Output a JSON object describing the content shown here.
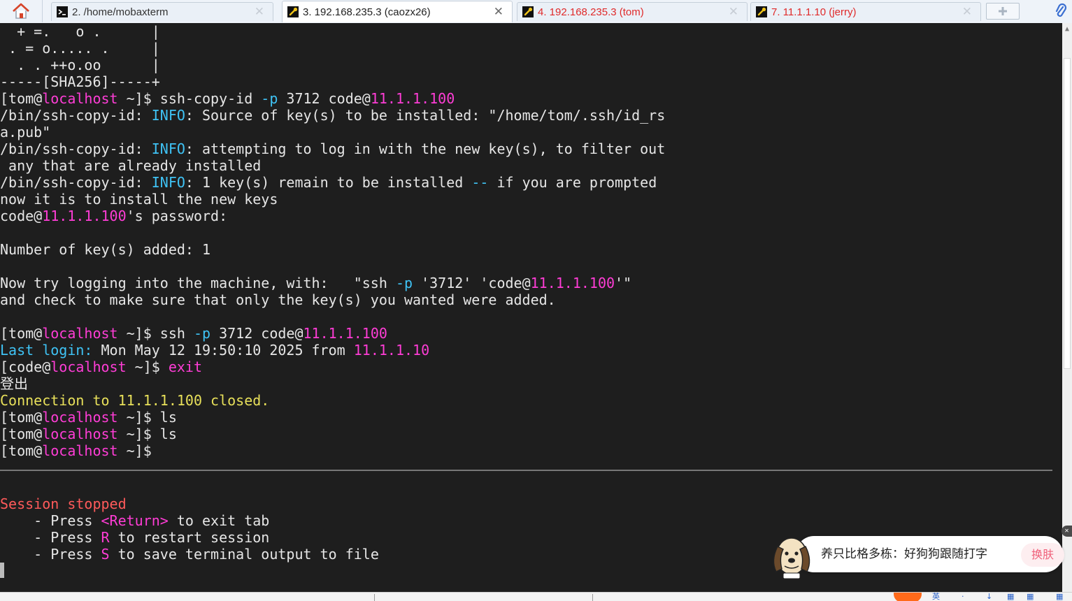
{
  "colors": {
    "default": "#e6e6e6",
    "magenta": "#ff3dd6",
    "cyan": "#3fc3f5",
    "yellow": "#e8e05a",
    "red": "#ff5a5a",
    "tab_active_text": "#222222",
    "tab_inactive_text": "#333333",
    "tab_remote_text": "#e02a2a"
  },
  "tabs": [
    {
      "label": "2. /home/mobaxterm",
      "icon": "terminal-icon",
      "state": "inactive",
      "remote": false,
      "close_faint": true
    },
    {
      "label": "3. 192.168.235.3 (caozx26)",
      "icon": "ssh-key-icon",
      "state": "active",
      "remote": false,
      "close_faint": false
    },
    {
      "label": "4. 192.168.235.3 (tom)",
      "icon": "ssh-key-icon",
      "state": "inactive",
      "remote": true,
      "close_faint": true
    },
    {
      "label": "7. 11.1.1.10 (jerry)",
      "icon": "ssh-key-icon",
      "state": "inactive",
      "remote": true,
      "close_faint": true
    }
  ],
  "terminal": {
    "lines": [
      [
        [
          "  + =.   o .      |",
          "default"
        ]
      ],
      [
        [
          " . = o..... .     |",
          "default"
        ]
      ],
      [
        [
          "  . . ++o.oo      |",
          "default"
        ]
      ],
      [
        [
          "-----[SHA256]-----+",
          "default"
        ]
      ],
      [
        [
          "[tom@",
          "default"
        ],
        [
          "localhost",
          "magenta"
        ],
        [
          " ~]$ ssh-copy-id ",
          "default"
        ],
        [
          "-p",
          "cyan"
        ],
        [
          " 3712 code@",
          "default"
        ],
        [
          "11.1.1.100",
          "magenta"
        ]
      ],
      [
        [
          "/bin/ssh-copy-id: ",
          "default"
        ],
        [
          "INFO",
          "cyan"
        ],
        [
          ": Source of key(s) to be installed: \"/home/tom/.ssh/id_rs",
          "default"
        ]
      ],
      [
        [
          "a.pub\"",
          "default"
        ]
      ],
      [
        [
          "/bin/ssh-copy-id: ",
          "default"
        ],
        [
          "INFO",
          "cyan"
        ],
        [
          ": attempting to log in with the new key(s), to filter out",
          "default"
        ]
      ],
      [
        [
          " any that are already installed",
          "default"
        ]
      ],
      [
        [
          "/bin/ssh-copy-id: ",
          "default"
        ],
        [
          "INFO",
          "cyan"
        ],
        [
          ": 1 key(s) remain to be installed ",
          "default"
        ],
        [
          "--",
          "cyan"
        ],
        [
          " if you are prompted",
          "default"
        ]
      ],
      [
        [
          "now it is to install the new keys",
          "default"
        ]
      ],
      [
        [
          "code@",
          "default"
        ],
        [
          "11.1.1.100",
          "magenta"
        ],
        [
          "'s password:",
          "default"
        ]
      ],
      [
        [
          "",
          "default"
        ]
      ],
      [
        [
          "Number of key(s) added: 1",
          "default"
        ]
      ],
      [
        [
          "",
          "default"
        ]
      ],
      [
        [
          "Now try logging into the machine, with:   \"ssh ",
          "default"
        ],
        [
          "-p",
          "cyan"
        ],
        [
          " '3712' 'code@",
          "default"
        ],
        [
          "11.1.1.100",
          "magenta"
        ],
        [
          "'\"",
          "default"
        ]
      ],
      [
        [
          "and check to make sure that only the key(s) you wanted were added.",
          "default"
        ]
      ],
      [
        [
          "",
          "default"
        ]
      ],
      [
        [
          "[tom@",
          "default"
        ],
        [
          "localhost",
          "magenta"
        ],
        [
          " ~]$ ssh ",
          "default"
        ],
        [
          "-p",
          "cyan"
        ],
        [
          " 3712 code@",
          "default"
        ],
        [
          "11.1.1.100",
          "magenta"
        ]
      ],
      [
        [
          "Last login:",
          "cyan"
        ],
        [
          " Mon May 12 19:50:10 2025 from ",
          "default"
        ],
        [
          "11.1.1.10",
          "magenta"
        ]
      ],
      [
        [
          "[code@",
          "default"
        ],
        [
          "localhost",
          "magenta"
        ],
        [
          " ~]$ ",
          "default"
        ],
        [
          "exit",
          "magenta"
        ]
      ],
      [
        [
          "登出",
          "default"
        ]
      ],
      [
        [
          "Connection to 11.1.1.100 closed.",
          "yellow"
        ]
      ],
      [
        [
          "[tom@",
          "default"
        ],
        [
          "localhost",
          "magenta"
        ],
        [
          " ~]$ ls",
          "default"
        ]
      ],
      [
        [
          "[tom@",
          "default"
        ],
        [
          "localhost",
          "magenta"
        ],
        [
          " ~]$ ls",
          "default"
        ]
      ],
      [
        [
          "[tom@",
          "default"
        ],
        [
          "localhost",
          "magenta"
        ],
        [
          " ~]$",
          "default"
        ]
      ]
    ],
    "after_separator": [
      [
        [
          "",
          "default"
        ]
      ],
      [
        [
          "Session stopped",
          "red"
        ]
      ],
      [
        [
          "    - Press ",
          "default"
        ],
        [
          "<Return>",
          "magenta"
        ],
        [
          " to exit tab",
          "default"
        ]
      ],
      [
        [
          "    - Press ",
          "default"
        ],
        [
          "R",
          "magenta"
        ],
        [
          " to restart session",
          "default"
        ]
      ],
      [
        [
          "    - Press ",
          "default"
        ],
        [
          "S",
          "magenta"
        ],
        [
          " to save terminal output to file",
          "default"
        ]
      ]
    ]
  },
  "ime_popup": {
    "text": "养只比格多栋：好狗狗跟随打字",
    "skin_button": "换肤",
    "mascot_icon": "beagle-dog-mascot-icon",
    "close_icon": "close-icon",
    "close_symbol": "✕"
  },
  "bottom_bar": {
    "glyphs": [
      "英",
      "·",
      "↓",
      "▦",
      "▦",
      "▦"
    ]
  }
}
